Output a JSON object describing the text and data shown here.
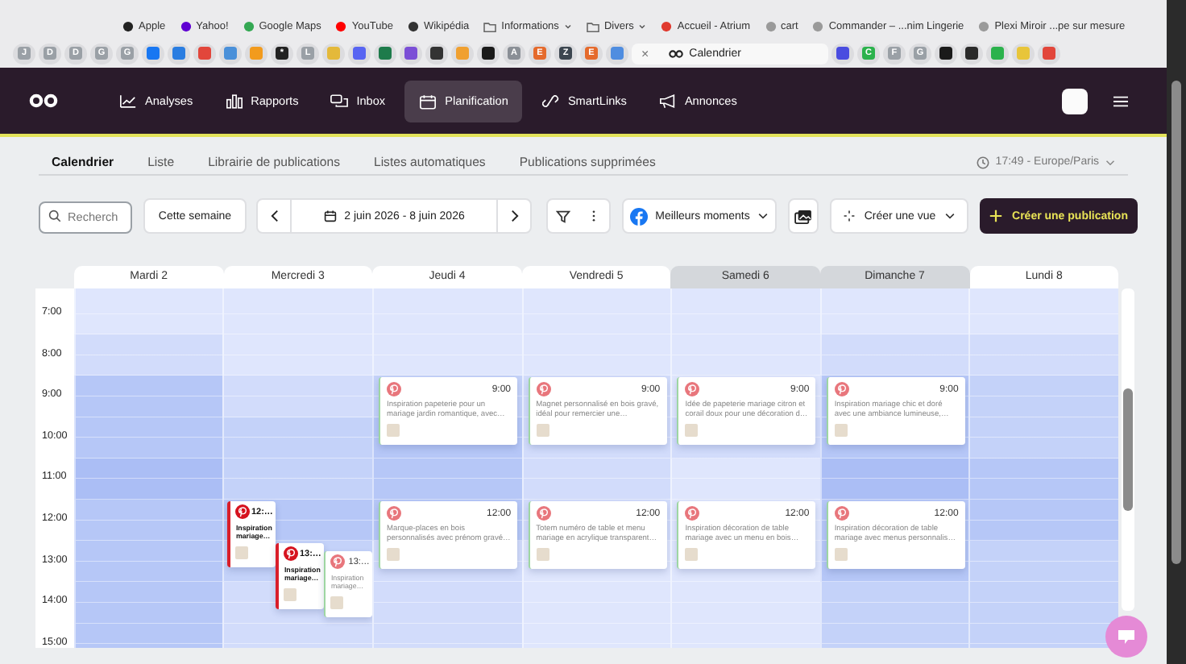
{
  "bookmarks": [
    {
      "kind": "link",
      "label": "Apple",
      "color": "#222222"
    },
    {
      "kind": "link",
      "label": "Yahoo!",
      "color": "#6001d2"
    },
    {
      "kind": "link",
      "label": "Google Maps",
      "color": "#34a853"
    },
    {
      "kind": "link",
      "label": "YouTube",
      "color": "#ff0000"
    },
    {
      "kind": "link",
      "label": "Wikipédia",
      "color": "#333333"
    },
    {
      "kind": "folder",
      "label": "Informations"
    },
    {
      "kind": "folder",
      "label": "Divers"
    },
    {
      "kind": "link",
      "label": "Accueil - Atrium",
      "color": "#e03a2f"
    },
    {
      "kind": "link",
      "label": "cart",
      "color": "#9a9a9a"
    },
    {
      "kind": "link",
      "label": "Commander – ...nim Lingerie",
      "color": "#9a9a9a"
    },
    {
      "kind": "link",
      "label": "Plexi Miroir ...pe sur mesure",
      "color": "#9a9a9a"
    }
  ],
  "browser_tabs": [
    {
      "letter": "J",
      "color": "#9aa0a6",
      "selected": false
    },
    {
      "letter": "D",
      "color": "#9aa0a6",
      "selected": false
    },
    {
      "letter": "D",
      "color": "#9aa0a6",
      "selected": false
    },
    {
      "letter": "G",
      "color": "#9aa0a6",
      "selected": false
    },
    {
      "letter": "G",
      "color": "#9aa0a6",
      "selected": false
    },
    {
      "color": "#1877f2",
      "selected": false
    },
    {
      "color": "#2a7de1",
      "selected": false
    },
    {
      "color": "#e2463b",
      "selected": false
    },
    {
      "color": "#4a90d9",
      "selected": false
    },
    {
      "color": "#f29b1d",
      "selected": false
    },
    {
      "letter": "*",
      "color": "#222222",
      "selected": false
    },
    {
      "letter": "L",
      "color": "#9aa0a6",
      "selected": false
    },
    {
      "color": "#e4b93a",
      "selected": false
    },
    {
      "color": "#5865f2",
      "selected": false
    },
    {
      "color": "#1e7b4b",
      "selected": false
    },
    {
      "color": "#7b4fd6",
      "selected": false
    },
    {
      "color": "#333333",
      "selected": false
    },
    {
      "color": "#f0a030",
      "selected": false
    },
    {
      "color": "#1a1a1a",
      "selected": false
    },
    {
      "letter": "A",
      "color": "#8a8f96",
      "selected": false
    },
    {
      "letter": "E",
      "color": "#e56a2c",
      "selected": false
    },
    {
      "letter": "Z",
      "color": "#3c4650",
      "selected": false
    },
    {
      "letter": "E",
      "color": "#e56a2c",
      "selected": false
    },
    {
      "color": "#4f8de0",
      "selected": false
    },
    {
      "close": "×",
      "label": "Calendrier",
      "selected": true
    },
    {
      "color": "#4a4de0",
      "selected": false
    },
    {
      "letter": "C",
      "color": "#2bb24c",
      "selected": false
    },
    {
      "letter": "F",
      "color": "#9aa0a6",
      "selected": false
    },
    {
      "letter": "G",
      "color": "#9aa0a6",
      "selected": false
    },
    {
      "color": "#1a1a1a",
      "selected": false
    },
    {
      "color": "#2a2a2a",
      "selected": false
    },
    {
      "color": "#2bb24c",
      "selected": false
    },
    {
      "color": "#e8c53a",
      "selected": false
    },
    {
      "color": "#e2463b",
      "selected": false
    }
  ],
  "nav": [
    {
      "kind": "chart",
      "label": "Analyses",
      "selected": false
    },
    {
      "kind": "bars",
      "label": "Rapports",
      "selected": false
    },
    {
      "kind": "inbox",
      "label": "Inbox",
      "selected": false
    },
    {
      "kind": "calendar",
      "label": "Planification",
      "selected": true
    },
    {
      "kind": "link",
      "label": "SmartLinks",
      "selected": false
    },
    {
      "kind": "megaphone",
      "label": "Annonces",
      "selected": false
    }
  ],
  "subtabs": [
    {
      "label": "Calendrier",
      "selected": true
    },
    {
      "label": "Liste",
      "selected": false
    },
    {
      "label": "Librairie de publications",
      "selected": false
    },
    {
      "label": "Listes automatiques",
      "selected": false
    },
    {
      "label": "Publications supprimées",
      "selected": false
    }
  ],
  "timezone": "17:49 - Europe/Paris",
  "toolbar": {
    "search": {
      "placeholder": "Recherch"
    },
    "this_week": "Cette semaine",
    "date_range": "2 juin 2026 - 8 juin 2026",
    "best_times": "Meilleurs moments",
    "create_view": "Créer une vue",
    "create_post": "Créer une publication"
  },
  "hours": [
    "7:00",
    "8:00",
    "9:00",
    "10:00",
    "11:00",
    "12:00",
    "13:00",
    "14:00",
    "15:00"
  ],
  "days": [
    {
      "label": "Mardi 2",
      "weekend": false
    },
    {
      "label": "Mercredi 3",
      "weekend": false,
      "posts": [
        {
          "kind": "noon",
          "time": "12:…",
          "text": "Inspiration mariage…",
          "error": true
        },
        {
          "kind": "afternoon",
          "time": "13:…",
          "text": "Inspiration mariage…",
          "error": true
        },
        {
          "kind": "afternoon",
          "time": "13:…",
          "text": "Inspiration mariage…",
          "error": false
        }
      ]
    },
    {
      "label": "Jeudi 4",
      "weekend": false,
      "posts": [
        {
          "kind": "morning",
          "time": "9:00",
          "text": "Inspiration papeterie pour un mariage jardin romantique, avec…",
          "error": false
        },
        {
          "kind": "noon",
          "time": "12:00",
          "text": "Marque-places en bois personnalisés avec prénom gravé…",
          "error": false
        }
      ]
    },
    {
      "label": "Vendredi 5",
      "weekend": false,
      "posts": [
        {
          "kind": "morning",
          "time": "9:00",
          "text": "Magnet personnalisé en bois gravé, idéal pour remercier une…",
          "error": false
        },
        {
          "kind": "noon",
          "time": "12:00",
          "text": "Totem numéro de table et menu mariage en acrylique transparent…",
          "error": false
        }
      ]
    },
    {
      "label": "Samedi 6",
      "weekend": true,
      "posts": [
        {
          "kind": "morning",
          "time": "9:00",
          "text": "Idée de papeterie mariage citron et corail doux pour une décoration d…",
          "error": false
        },
        {
          "kind": "noon",
          "time": "12:00",
          "text": "Inspiration décoration de table mariage avec un menu en bois…",
          "error": false
        }
      ]
    },
    {
      "label": "Dimanche 7",
      "weekend": true,
      "posts": [
        {
          "kind": "morning",
          "time": "9:00",
          "text": "Inspiration mariage chic et doré avec une ambiance lumineuse,…",
          "error": false
        },
        {
          "kind": "noon",
          "time": "12:00",
          "text": "Inspiration décoration de table mariage avec menus personnalis…",
          "error": false
        }
      ]
    },
    {
      "label": "Lundi 8",
      "weekend": false
    }
  ]
}
